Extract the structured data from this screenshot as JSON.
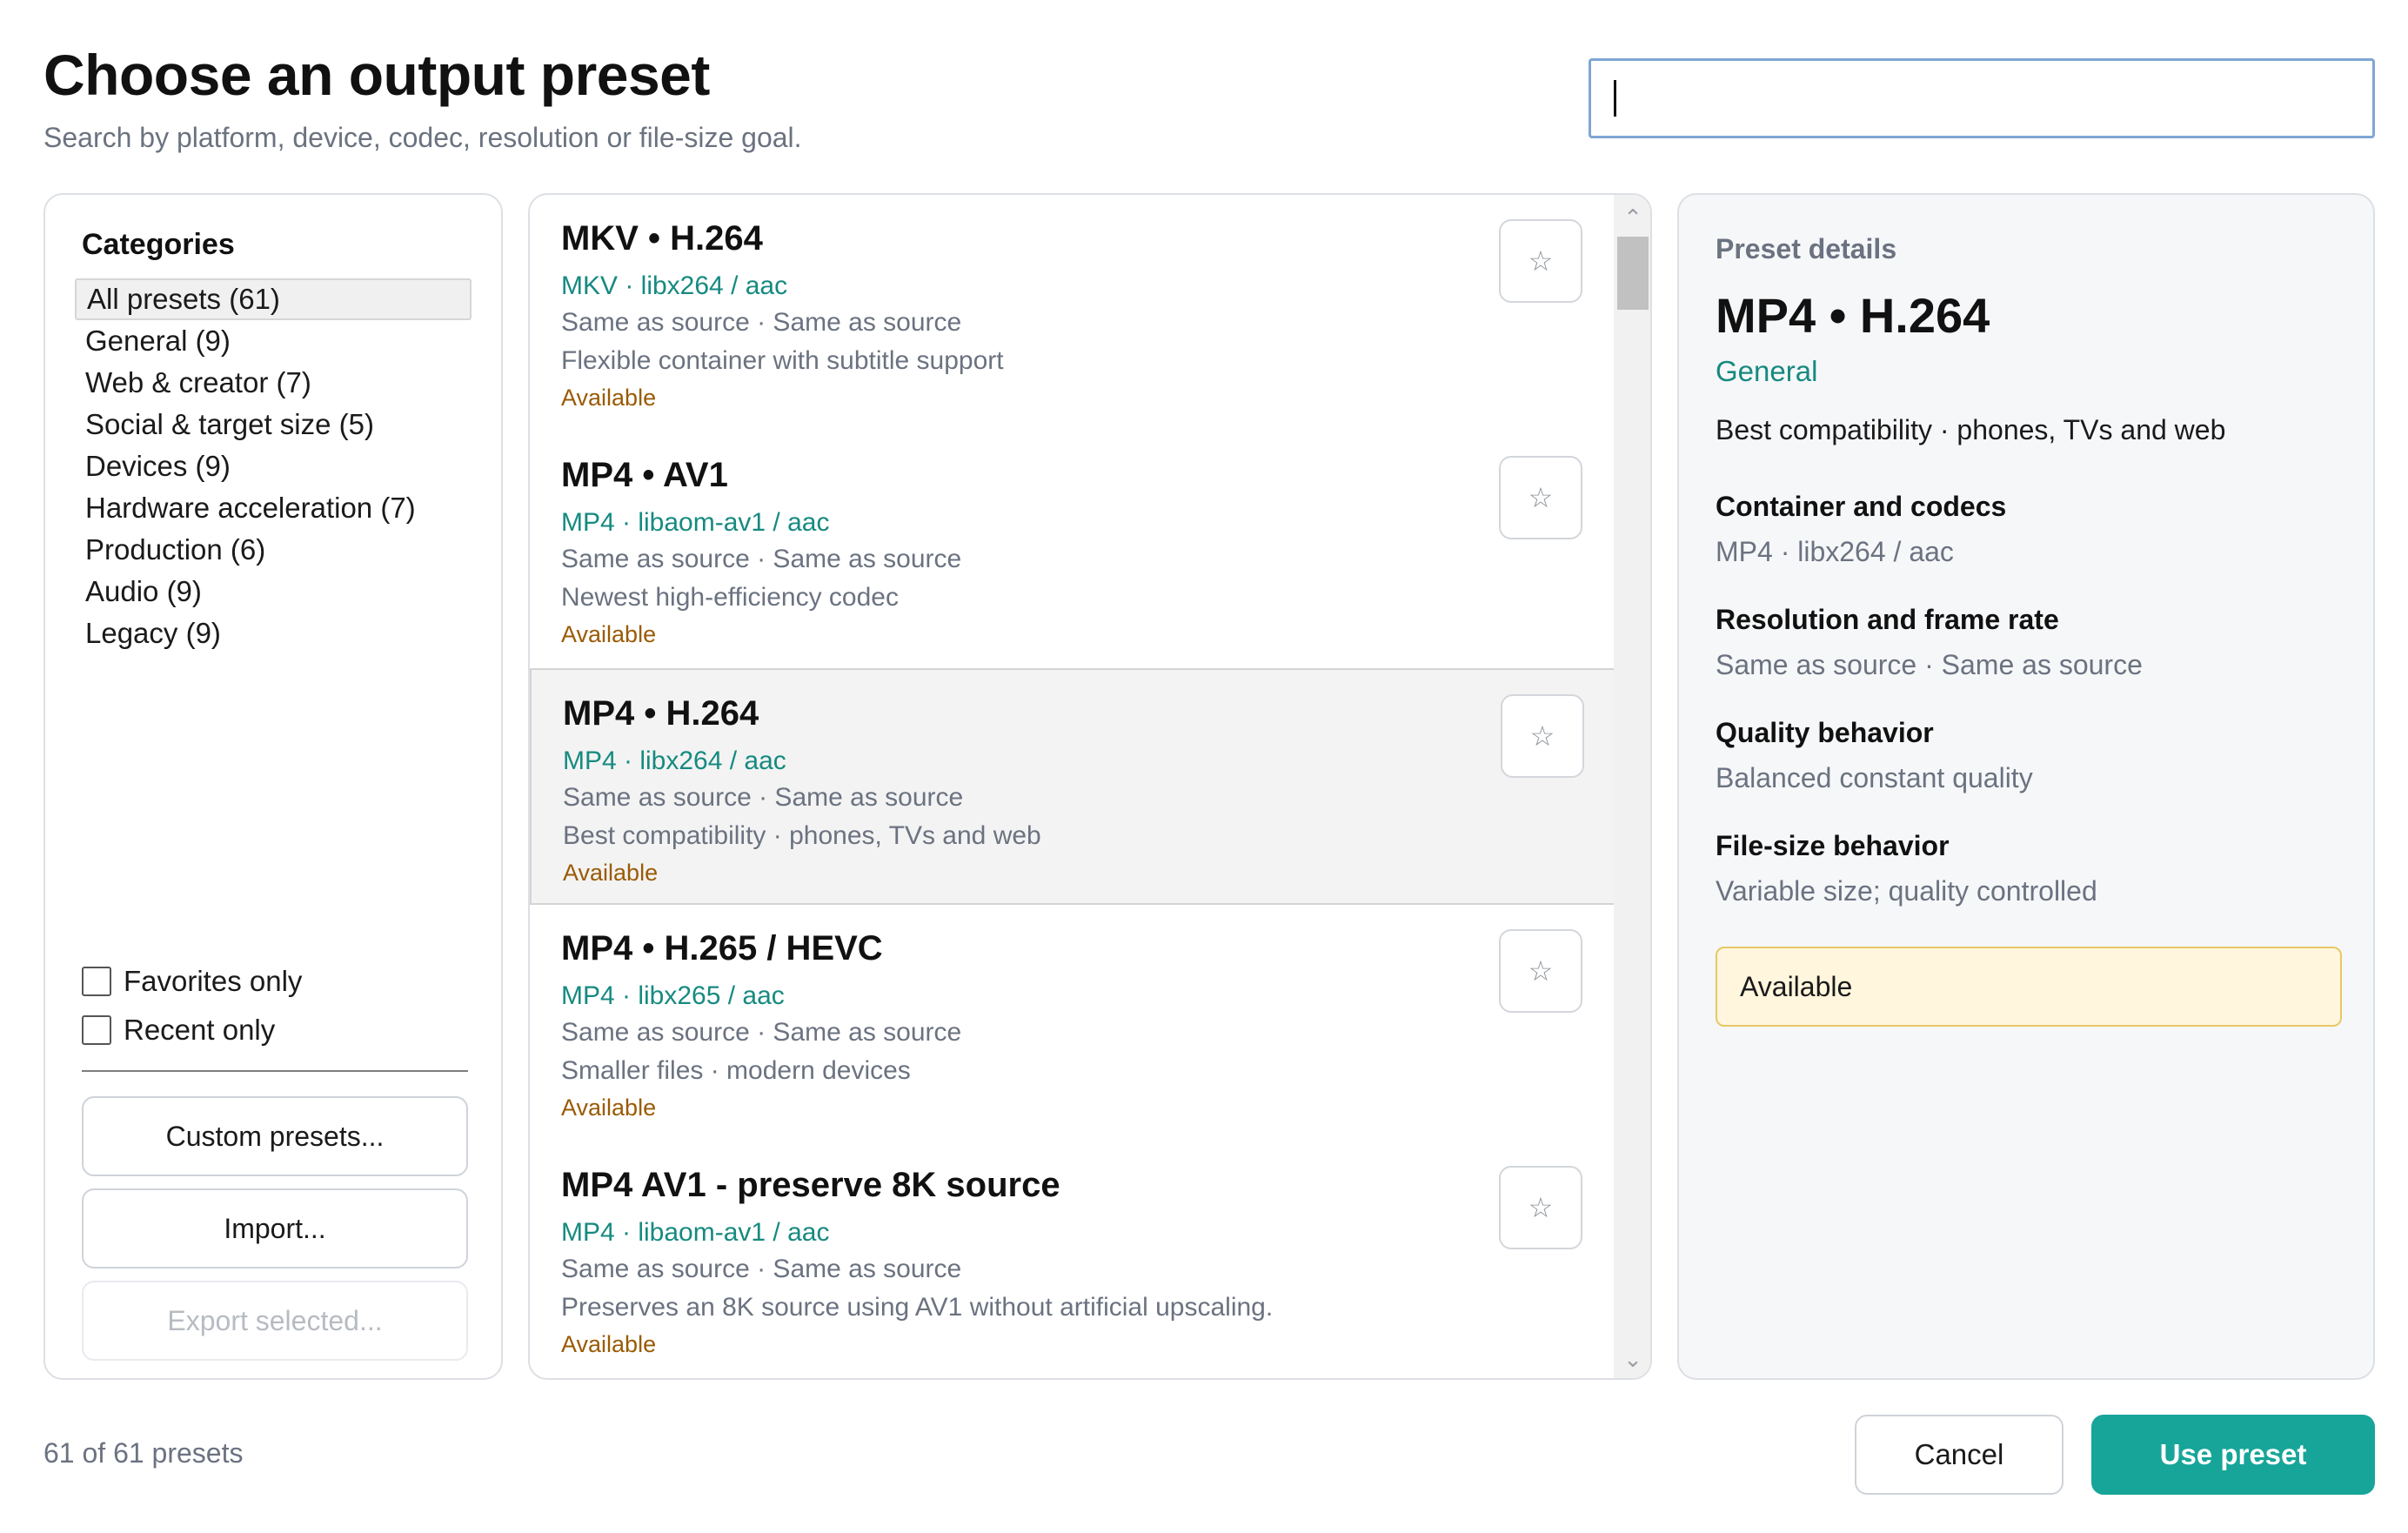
{
  "header": {
    "title": "Choose an output preset",
    "subtitle": "Search by platform, device, codec, resolution or file-size goal.",
    "search_value": ""
  },
  "categories": {
    "heading": "Categories",
    "items": [
      {
        "label": "All presets (61)",
        "selected": true
      },
      {
        "label": "General (9)"
      },
      {
        "label": "Web & creator (7)"
      },
      {
        "label": "Social & target size (5)"
      },
      {
        "label": "Devices (9)"
      },
      {
        "label": "Hardware acceleration (7)"
      },
      {
        "label": "Production (6)"
      },
      {
        "label": "Audio (9)"
      },
      {
        "label": "Legacy (9)"
      }
    ],
    "favorites_label": "Favorites only",
    "recent_label": "Recent only",
    "custom_presets_label": "Custom presets...",
    "import_label": "Import...",
    "export_label": "Export selected..."
  },
  "presets": [
    {
      "name": "MKV • H.264",
      "codec": "MKV · libx264 / aac",
      "res": "Same as source · Same as source",
      "desc": "Flexible container with subtitle support",
      "status": "Available",
      "star": "☆"
    },
    {
      "name": "MP4 • AV1",
      "codec": "MP4 · libaom-av1 / aac",
      "res": "Same as source · Same as source",
      "desc": "Newest high-efficiency codec",
      "status": "Available",
      "star": "☆"
    },
    {
      "name": "MP4 • H.264",
      "codec": "MP4 · libx264 / aac",
      "res": "Same as source · Same as source",
      "desc": "Best compatibility · phones, TVs and web",
      "status": "Available",
      "star": "☆",
      "selected": true
    },
    {
      "name": "MP4 • H.265 / HEVC",
      "codec": "MP4 · libx265 / aac",
      "res": "Same as source · Same as source",
      "desc": "Smaller files · modern devices",
      "status": "Available",
      "star": "☆"
    },
    {
      "name": "MP4 AV1 - preserve 8K source",
      "codec": "MP4 · libaom-av1 / aac",
      "res": "Same as source · Same as source",
      "desc": "Preserves an 8K source using AV1 without artificial upscaling.",
      "status": "Available",
      "star": "☆"
    }
  ],
  "scrollbar": {
    "up": "⌃",
    "down": "⌄"
  },
  "details": {
    "heading": "Preset details",
    "name": "MP4 • H.264",
    "category": "General",
    "summary": "Best compatibility · phones, TVs and web",
    "container_label": "Container and codecs",
    "container_value": "MP4 · libx264 / aac",
    "resolution_label": "Resolution and frame rate",
    "resolution_value": "Same as source · Same as source",
    "quality_label": "Quality behavior",
    "quality_value": "Balanced constant quality",
    "filesize_label": "File-size behavior",
    "filesize_value": "Variable size; quality controlled",
    "status": "Available"
  },
  "footer": {
    "count": "61 of 61 presets",
    "cancel_label": "Cancel",
    "use_label": "Use preset"
  },
  "colors": {
    "accent": "#17a599",
    "codec_text": "#168a80",
    "status_text": "#9a5b05",
    "status_bg": "#fff6dd"
  }
}
